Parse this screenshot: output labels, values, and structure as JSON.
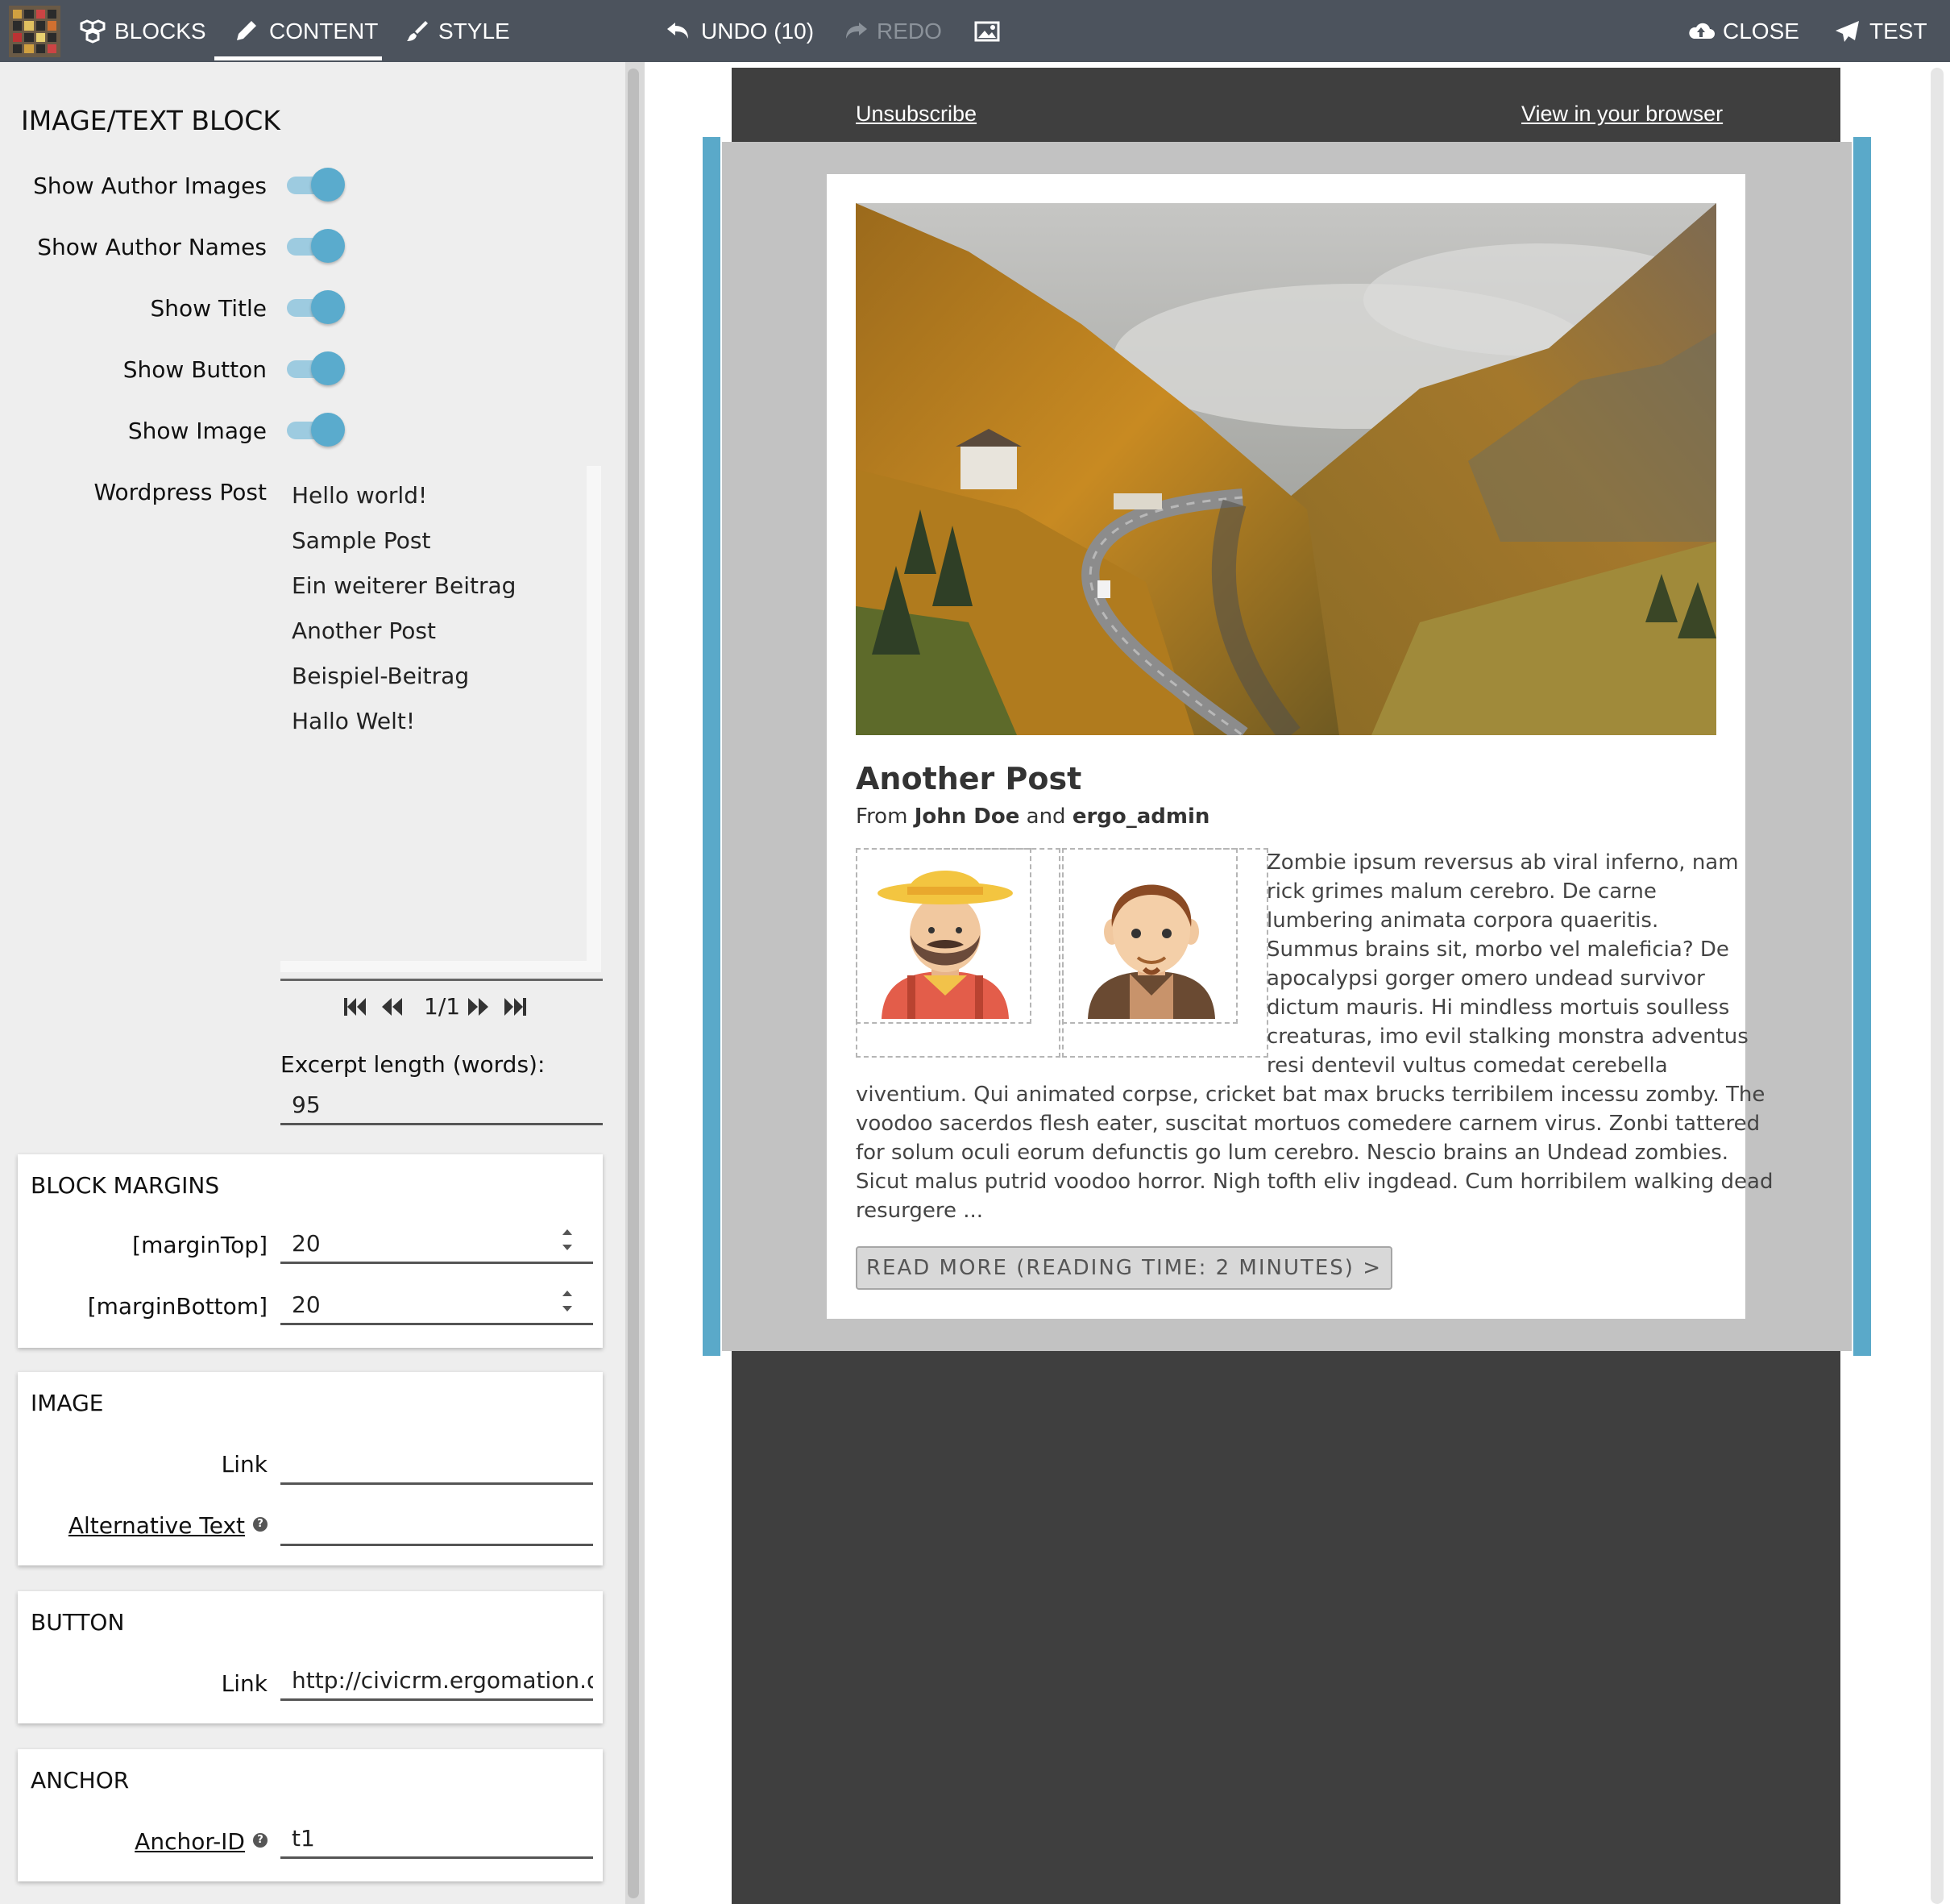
{
  "toolbar": {
    "blocks": "BLOCKS",
    "content": "CONTENT",
    "style": "STYLE",
    "undo": "UNDO (10)",
    "redo": "REDO",
    "close": "CLOSE",
    "test": "TEST",
    "active_tab": "CONTENT",
    "icons": [
      "logo",
      "cubes-icon",
      "pencil-icon",
      "brush-icon",
      "undo-icon",
      "redo-icon",
      "image-icon",
      "cloud-upload-icon",
      "paper-plane-icon"
    ]
  },
  "left_panel": {
    "title": "IMAGE/TEXT BLOCK",
    "toggles": [
      {
        "label": "Show Author Images",
        "on": true
      },
      {
        "label": "Show Author Names",
        "on": true
      },
      {
        "label": "Show Title",
        "on": true
      },
      {
        "label": "Show Button",
        "on": true
      },
      {
        "label": "Show Image",
        "on": true
      }
    ],
    "wordpress_post": {
      "label": "Wordpress Post",
      "items": [
        "Hello world!",
        "Sample Post",
        "Ein weiterer Beitrag",
        "Another Post",
        "Beispiel-Beitrag",
        "Hallo Welt!"
      ],
      "pager": "1/1"
    },
    "excerpt": {
      "label": "Excerpt length (words):",
      "value": "95"
    },
    "block_margins": {
      "title": "BLOCK MARGINS",
      "margin_top_label": "[marginTop]",
      "margin_top_value": "20",
      "margin_bottom_label": "[marginBottom]",
      "margin_bottom_value": "20"
    },
    "image": {
      "title": "IMAGE",
      "link_label": "Link",
      "link_value": "",
      "alt_label": "Alternative Text",
      "alt_value": ""
    },
    "button": {
      "title": "BUTTON",
      "link_label": "Link",
      "link_value": "http://civicrm.ergomation.de"
    },
    "anchor": {
      "title": "ANCHOR",
      "id_label": "Anchor-ID",
      "id_value": "t1"
    }
  },
  "preview": {
    "unsubscribe": "Unsubscribe",
    "view_in_browser": "View in your browser",
    "post_title": "Another Post",
    "byline_from": "From",
    "author1": "John Doe",
    "byline_and": "and",
    "author2": "ergo_admin",
    "text_lines_wrapped": [
      "Zombie ipsum reversus ab viral inferno, nam",
      "rick grimes malum cerebro. De carne",
      "lumbering animata corpora quaeritis.",
      "Summus brains sit, morbo vel maleficia? De",
      "apocalypsi gorger omero undead survivor",
      "dictum mauris. Hi mindless mortuis soulless",
      "creaturas, imo evil stalking monstra adventus",
      "resi dentevil vultus comedat cerebella"
    ],
    "text_lines_full": [
      "viventium. Qui animated corpse, cricket bat max brucks terribilem incessu zomby. The",
      "voodoo sacerdos flesh eater, suscitat mortuos comedere carnem virus. Zonbi tattered",
      "for solum oculi eorum defunctis go lum cerebro. Nescio brains an Undead zombies.",
      "Sicut malus putrid voodoo horror. Nigh tofth eliv ingdead. Cum horribilem walking dead",
      "resurgere ..."
    ],
    "read_more": "READ MORE (READING TIME: 2 MINUTES) >"
  },
  "colors": {
    "toolbar_bg": "#4c535d",
    "panel_bg": "#eeeeee",
    "toggle_accent": "#5aabcd",
    "email_dark": "#3f3f3f",
    "email_gray": "#c2c2c2",
    "selection_blue": "#5aa9c9"
  }
}
